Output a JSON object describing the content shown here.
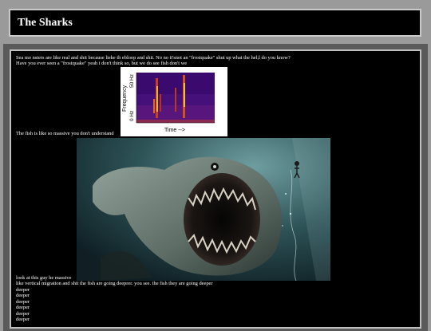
{
  "header": {
    "title": "The Sharks"
  },
  "content": {
    "paragraph_1": "Sea mo nsters are like real and shit because lieke th ebloop and shit. No no it'snot an \"frostquake\" shut up what the hel;l do you know?",
    "paragraph_2": "Have you ever seen a \"frostquake\" yeah i don't think so, but we do see fish don't we",
    "caption_1": "The fish is like so massive you don't understand",
    "caption_2": "look at this guy he massive",
    "paragraph_3": "like vertical migration and shit the fish are going deeprer. you see. the fish they are going deeper",
    "deeper_lines": [
      "deeper",
      "deeper",
      "deeper",
      "deeper",
      "deeper",
      "deeper"
    ]
  },
  "spectrogram": {
    "y_label": "Frequency",
    "y_top_tick": "50 Hz",
    "y_bottom_tick": "0 Hz",
    "x_label": "Time -->"
  },
  "colors": {
    "page_background": "#9a9a9a",
    "panel_background": "#000000",
    "text": "#ffffff",
    "spectrogram_background": "#3a0a6e"
  }
}
